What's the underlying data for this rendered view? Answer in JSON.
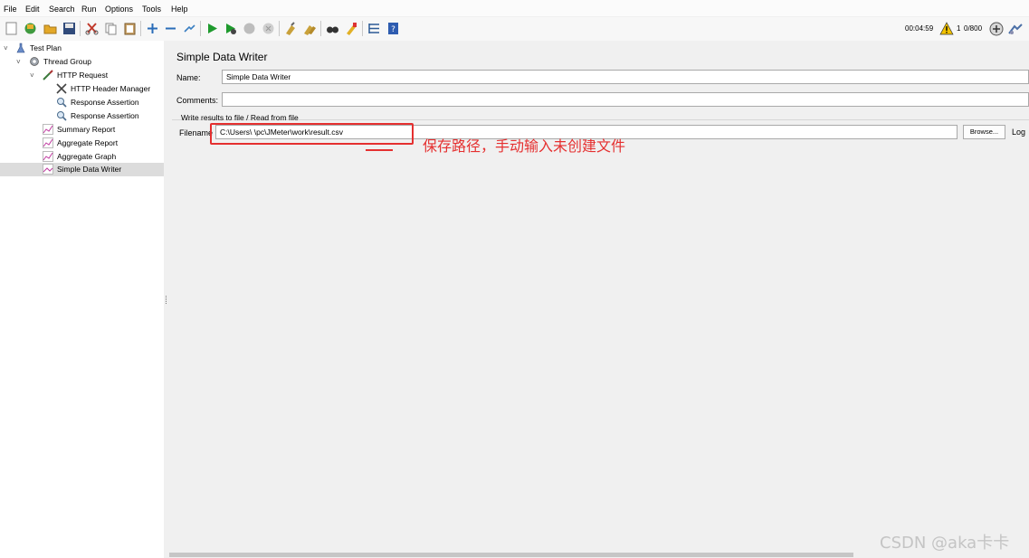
{
  "menu": {
    "file": "File",
    "edit": "Edit",
    "search": "Search",
    "run": "Run",
    "options": "Options",
    "tools": "Tools",
    "help": "Help"
  },
  "status": {
    "elapsed": "00:04:59",
    "warnings": "1",
    "threads": "0/800"
  },
  "tree": {
    "test_plan": "Test Plan",
    "thread_group": "Thread Group",
    "http_request": "HTTP Request",
    "http_header_manager": "HTTP Header Manager",
    "response_assertion_1": "Response Assertion",
    "response_assertion_2": "Response Assertion",
    "summary_report": "Summary Report",
    "aggregate_report": "Aggregate Report",
    "aggregate_graph": "Aggregate Graph",
    "simple_data_writer": "Simple Data Writer"
  },
  "panel": {
    "title": "Simple Data Writer",
    "name_label": "Name:",
    "name_value": "Simple Data Writer",
    "comments_label": "Comments:",
    "comments_value": "",
    "group_title": "Write results to file / Read from file",
    "filename_label": "Filename",
    "filename_value": "C:\\Users\\              \\pc\\JMeter\\work\\result.csv",
    "browse_label": "Browse...",
    "log_tail": "Log"
  },
  "annotation": {
    "text": "保存路径，手动输入未创建文件",
    "color": "#e53030"
  },
  "watermark": "CSDN @aka卡卡"
}
